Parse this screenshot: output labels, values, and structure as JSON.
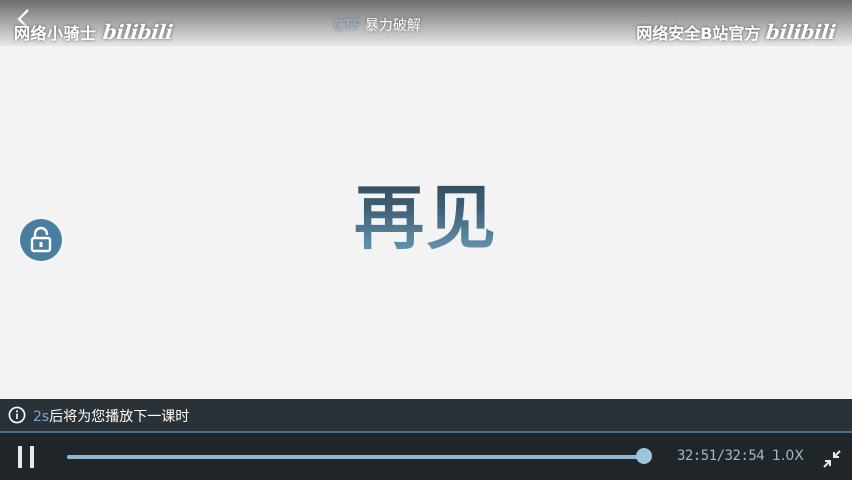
{
  "header": {
    "channel_left": "网络小骑士",
    "logo_left": "bilibili",
    "video_title_prefix": "CTF",
    "video_title": "暴力破解",
    "channel_right": "网络安全B站官方",
    "logo_right": "bilibili"
  },
  "video": {
    "center_text": "再见"
  },
  "notice": {
    "countdown": "2s",
    "message": "后将为您播放下一课时"
  },
  "controls": {
    "current_time": "32:51",
    "separator": "/",
    "total_time": "32:54",
    "speed_label": "1.0X",
    "progress_fraction": 0.998
  },
  "icons": {
    "back": "back-arrow-icon",
    "lock": "lock-icon",
    "info": "info-icon",
    "pause": "pause-icon",
    "exit_fullscreen": "exit-fullscreen-icon"
  },
  "colors": {
    "accent": "#8fb8d0",
    "notice_count": "#6fa8d6",
    "lock_bg": "#4a7ea1"
  }
}
